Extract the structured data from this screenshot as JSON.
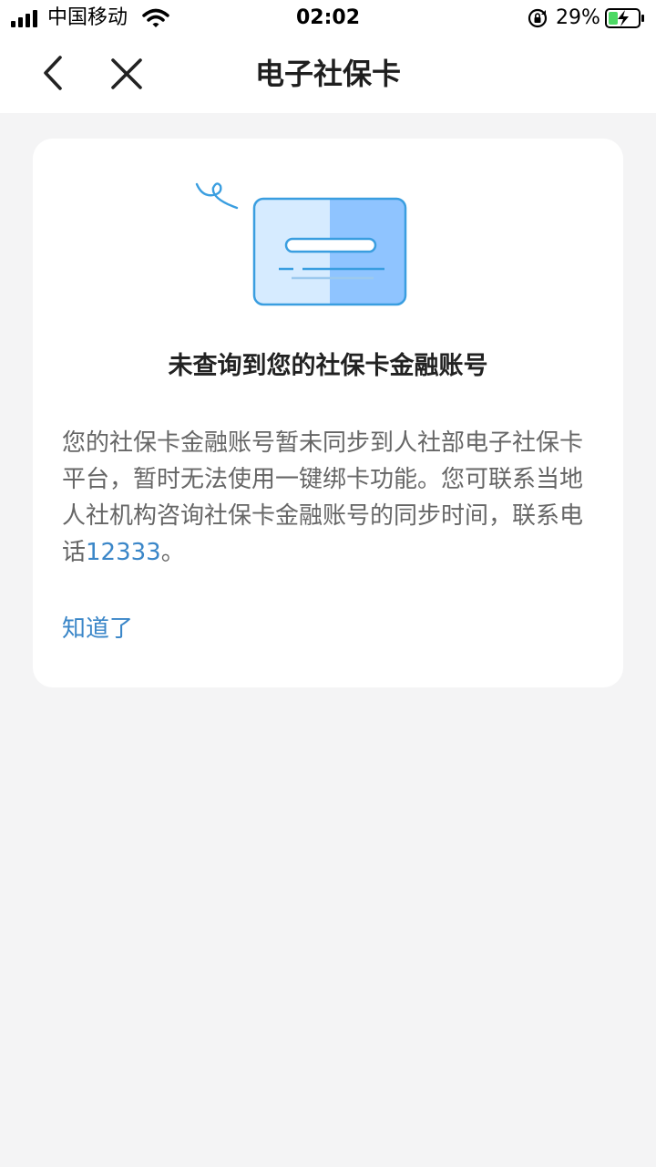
{
  "status_bar": {
    "carrier": "中国移动",
    "time": "02:02",
    "battery_percent": "29%",
    "icons": [
      "signal-icon",
      "wifi-icon",
      "rotation-lock-icon",
      "battery-charging-icon"
    ]
  },
  "nav": {
    "title": "电子社保卡",
    "icons": [
      "back-icon",
      "close-icon"
    ]
  },
  "dialog": {
    "illustration": "card-illustration",
    "heading": "未查询到您的社保卡金融账号",
    "body_text": "您的社保卡金融账号暂未同步到人社部电子社保卡平台，暂时无法使用一键绑卡功能。您可联系当地人社机构咨询社保卡金融账号的同步时间，联系电话",
    "phone_number": "12333",
    "body_suffix": "。",
    "confirm_label": "知道了"
  },
  "colors": {
    "accent": "#3a86c8",
    "background": "#f4f4f5",
    "card_light": "#d6ebff",
    "card_dark": "#8fc4ff",
    "card_border": "#3a9ee0",
    "battery_green": "#4cd964"
  }
}
